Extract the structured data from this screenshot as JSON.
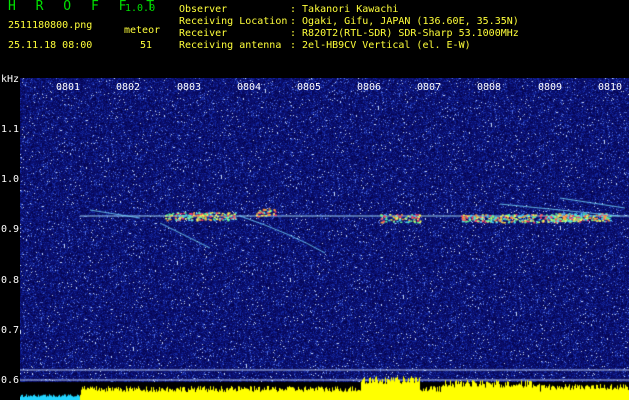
{
  "header": {
    "app_name": "H R O F F T",
    "version": "1.0.0",
    "filename": "2511180800.png",
    "datetime": "25.11.18 08:00",
    "meteor_label": "meteor",
    "meteor_count": "51",
    "observer_label": "Observer",
    "observer_value": ": Takanori Kawachi",
    "location_label": "Receiving Location",
    "location_value": ": Ogaki, Gifu, JAPAN (136.60E, 35.35N)",
    "receiver_label": "Receiver",
    "receiver_value": ": R820T2(RTL-SDR) SDR-Sharp 53.1000MHz",
    "antenna_label": "Receiving antenna",
    "antenna_value": ": 2el-HB9CV Vertical (el. E-W)"
  },
  "axes": {
    "y_unit": "kHz",
    "x_ticks": [
      "0801",
      "0802",
      "0803",
      "0804",
      "0805",
      "0806",
      "0807",
      "0808",
      "0809",
      "0810"
    ],
    "y_ticks": [
      "1.1",
      "1.0",
      "0.9",
      "0.8",
      "0.7",
      "0.6"
    ]
  },
  "colors": {
    "background": "#000000",
    "spectrogram_base": "#0a0f7a",
    "header_green": "#00e000",
    "header_yellow": "#ffff3a",
    "baseline_yellow": "#ffff00"
  }
}
